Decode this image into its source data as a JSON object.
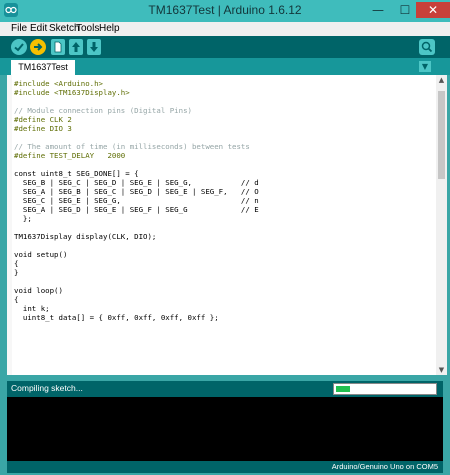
{
  "window": {
    "title": "TM1637Test | Arduino 1.6.12",
    "min_glyph": "—",
    "max_glyph": "☐",
    "close_glyph": "✕"
  },
  "menubar": {
    "items": [
      "File",
      "Edit",
      "Sketch",
      "Tools",
      "Help"
    ]
  },
  "toolbar": {
    "buttons": [
      "verify-icon",
      "upload-icon",
      "new-icon",
      "open-icon",
      "save-icon"
    ],
    "serial_monitor_icon": "magnifier-icon"
  },
  "tabs": {
    "active": "TM1637Test",
    "menu_glyph": "▼"
  },
  "editor": {
    "lines": [
      "#include <Arduino.h>",
      "#include <TM1637Display.h>",
      "",
      "// Module connection pins (Digital Pins)",
      "#define CLK 2",
      "#define DIO 3",
      "",
      "// The amount of time (in milliseconds) between tests",
      "#define TEST_DELAY   2000",
      "",
      "const uint8_t SEG_DONE[] = {",
      "  SEG_B | SEG_C | SEG_D | SEG_E | SEG_G,           // d",
      "  SEG_A | SEG_B | SEG_C | SEG_D | SEG_E | SEG_F,   // O",
      "  SEG_C | SEG_E | SEG_G,                           // n",
      "  SEG_A | SEG_D | SEG_E | SEG_F | SEG_G            // E",
      "  };",
      "",
      "TM1637Display display(CLK, DIO);",
      "",
      "void setup()",
      "{",
      "}",
      "",
      "void loop()",
      "{",
      "  int k;",
      "  uint8_t data[] = { 0xff, 0xff, 0xff, 0xff };"
    ]
  },
  "status": {
    "text": "Compiling sketch...",
    "progress": 0.14
  },
  "board": {
    "text": "Arduino/Genuino Uno on COM5"
  },
  "colors": {
    "accent": "#006468",
    "title_bg": "#3fbcbc",
    "progress": "#23c050"
  }
}
